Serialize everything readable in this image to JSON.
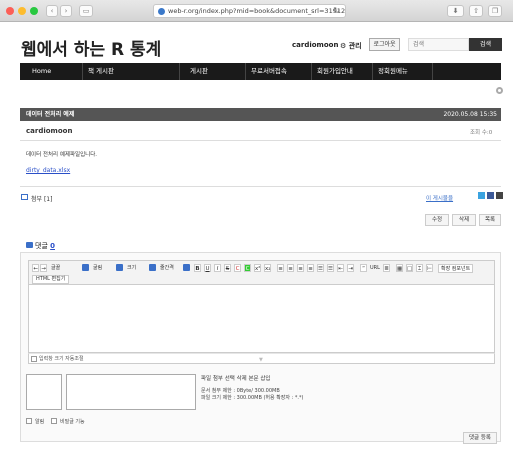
{
  "browser": {
    "url": "web-r.org/index.php?mid=book&document_srl=31912"
  },
  "site": {
    "title": "웹에서 하는 R 통계",
    "username": "cardiomoon",
    "admin_label": "관리",
    "logout_label": "로그아웃",
    "search_placeholder": "검색",
    "search_button": "검색"
  },
  "nav": {
    "items": [
      "Home",
      "책 게시판",
      "게시판",
      "무료서버접속",
      "회원가입안내",
      "정회원메뉴"
    ]
  },
  "post": {
    "title": "데이터 전처리 예제",
    "date": "2020.05.08 15:35",
    "author": "cardiomoon",
    "views_label": "조회 수:0",
    "content": "데이터 전처리 예제파일입니다.",
    "file_link": "dirty_data.xlsx",
    "attach_label": "첨부 [1]",
    "other_posts_label": "이 게시물을",
    "buttons": [
      "수정",
      "삭제",
      "목록"
    ]
  },
  "comments": {
    "label": "댓글",
    "count": "0",
    "toolbar": {
      "items": [
        "글꼴",
        "굴림",
        "크기",
        "줄간격"
      ],
      "url_label": "URL",
      "ext_label": "확장 컴포넌트",
      "html_edit": "HTML 편집기"
    },
    "autosize_label": "입력창 크기 자동조절",
    "upload_button": "파일 첨부 선택 삭제 본문 삽입",
    "upload_info_1": "문서 첨부 제한 : 0Byte/ 300.00MB",
    "upload_info_2": "파일 크기 제한 : 300.00MB (허용 확장자 : *.*)",
    "option_notify": "알림",
    "option_secret": "비밀글 기능",
    "submit_label": "댓글 등록"
  }
}
